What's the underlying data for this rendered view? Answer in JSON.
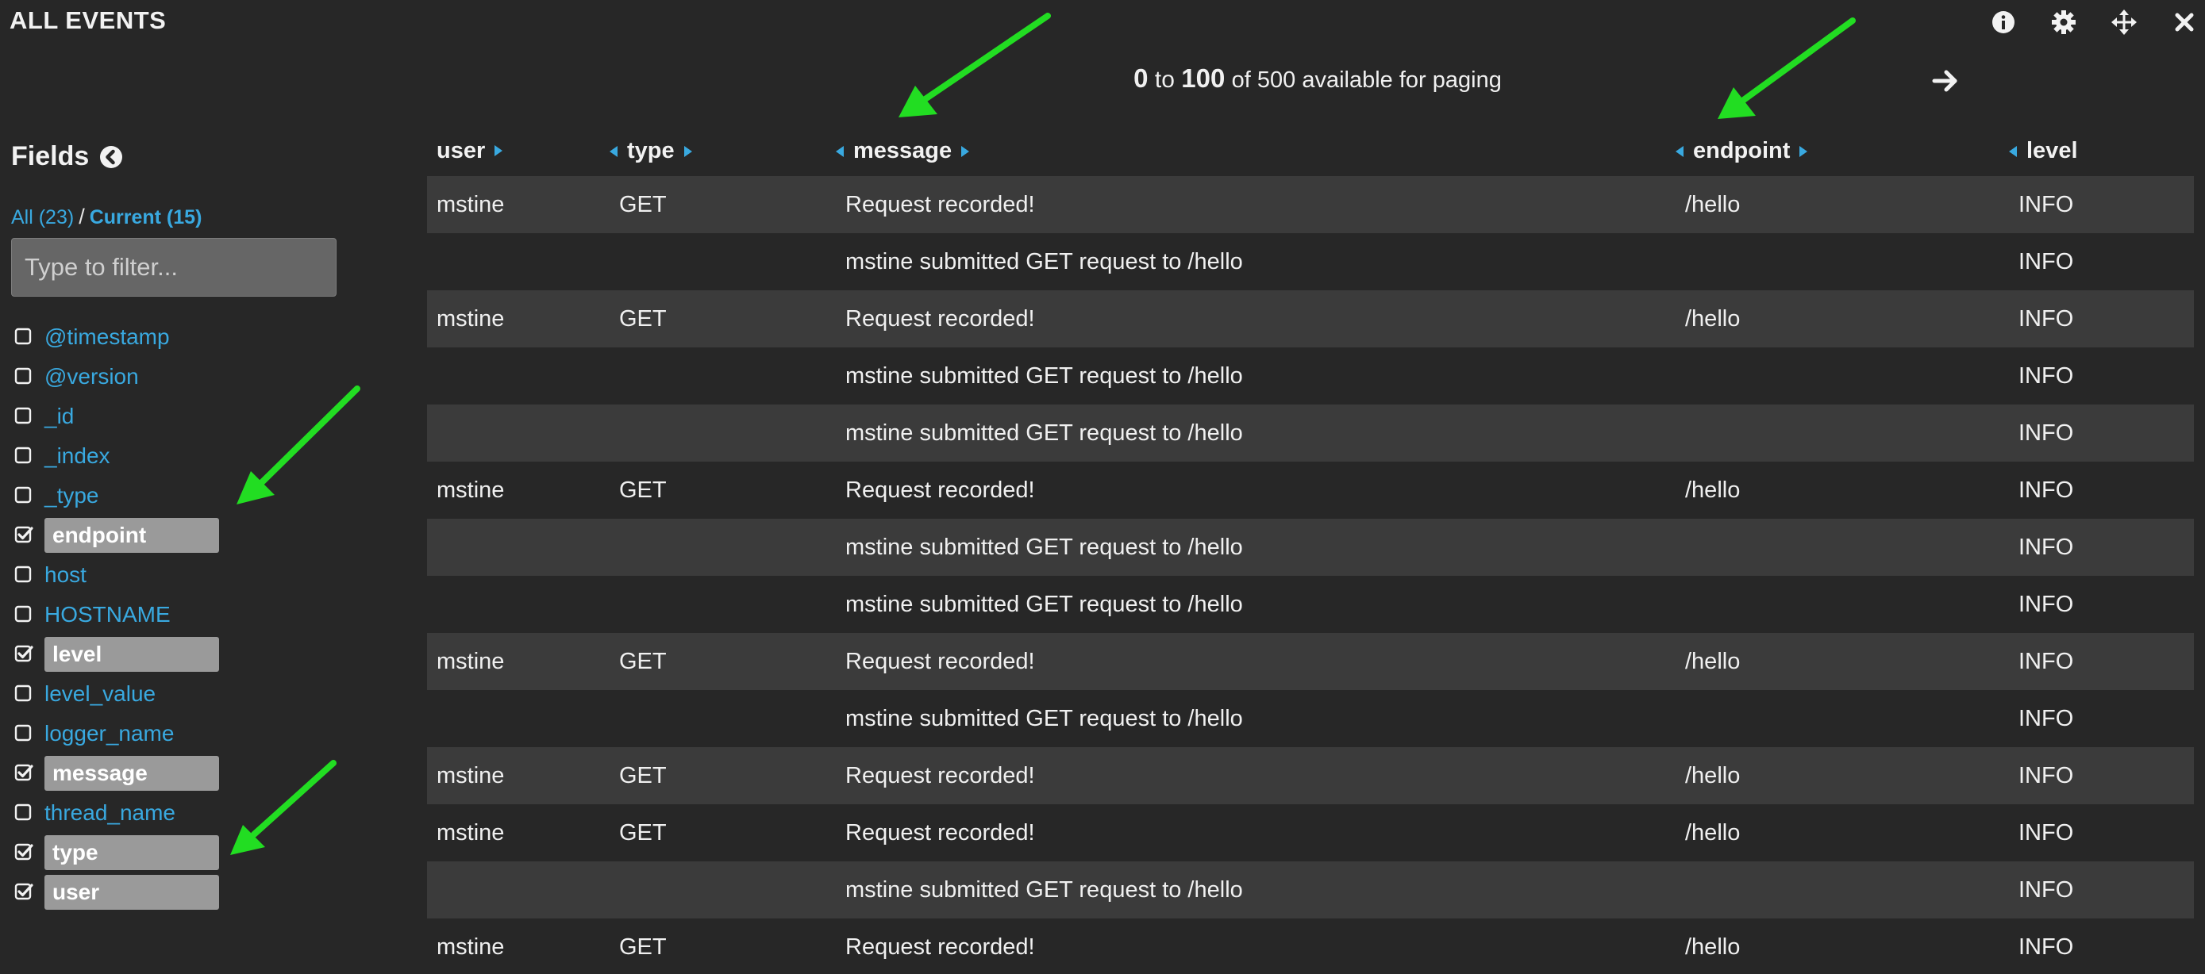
{
  "header": {
    "title": "ALL EVENTS"
  },
  "toolbar": {
    "icons": [
      "info-icon",
      "gear-icon",
      "move-icon",
      "close-icon"
    ]
  },
  "paging": {
    "from": "0",
    "to_word": "to",
    "to": "100",
    "rest": "of 500 available for paging"
  },
  "sidebar": {
    "heading": "Fields",
    "all_label": "All (23)",
    "separator": "/",
    "current_label": "Current (15)",
    "filter_placeholder": "Type to filter...",
    "fields": [
      {
        "name": "@timestamp",
        "checked": false
      },
      {
        "name": "@version",
        "checked": false
      },
      {
        "name": "_id",
        "checked": false
      },
      {
        "name": "_index",
        "checked": false
      },
      {
        "name": "_type",
        "checked": false
      },
      {
        "name": "endpoint",
        "checked": true
      },
      {
        "name": "host",
        "checked": false
      },
      {
        "name": "HOSTNAME",
        "checked": false
      },
      {
        "name": "level",
        "checked": true
      },
      {
        "name": "level_value",
        "checked": false
      },
      {
        "name": "logger_name",
        "checked": false
      },
      {
        "name": "message",
        "checked": true
      },
      {
        "name": "thread_name",
        "checked": false
      },
      {
        "name": "type",
        "checked": true
      },
      {
        "name": "user",
        "checked": true
      }
    ]
  },
  "table": {
    "columns": [
      {
        "key": "user",
        "label": "user"
      },
      {
        "key": "type",
        "label": "type"
      },
      {
        "key": "message",
        "label": "message"
      },
      {
        "key": "endpoint",
        "label": "endpoint"
      },
      {
        "key": "level",
        "label": "level"
      }
    ],
    "rows": [
      [
        "mstine",
        "GET",
        "Request recorded!",
        "/hello",
        "INFO"
      ],
      [
        "",
        "",
        "mstine submitted GET request to /hello",
        "",
        "INFO"
      ],
      [
        "mstine",
        "GET",
        "Request recorded!",
        "/hello",
        "INFO"
      ],
      [
        "",
        "",
        "mstine submitted GET request to /hello",
        "",
        "INFO"
      ],
      [
        "",
        "",
        "mstine submitted GET request to /hello",
        "",
        "INFO"
      ],
      [
        "mstine",
        "GET",
        "Request recorded!",
        "/hello",
        "INFO"
      ],
      [
        "",
        "",
        "mstine submitted GET request to /hello",
        "",
        "INFO"
      ],
      [
        "",
        "",
        "mstine submitted GET request to /hello",
        "",
        "INFO"
      ],
      [
        "mstine",
        "GET",
        "Request recorded!",
        "/hello",
        "INFO"
      ],
      [
        "",
        "",
        "mstine submitted GET request to /hello",
        "",
        "INFO"
      ],
      [
        "mstine",
        "GET",
        "Request recorded!",
        "/hello",
        "INFO"
      ],
      [
        "mstine",
        "GET",
        "Request recorded!",
        "/hello",
        "INFO"
      ],
      [
        "",
        "",
        "mstine submitted GET request to /hello",
        "",
        "INFO"
      ],
      [
        "mstine",
        "GET",
        "Request recorded!",
        "/hello",
        "INFO"
      ]
    ]
  },
  "colors": {
    "accent": "#39a9e0",
    "annotation": "#22dd22",
    "background": "#272727",
    "row_alt": "#3b3b3b"
  }
}
